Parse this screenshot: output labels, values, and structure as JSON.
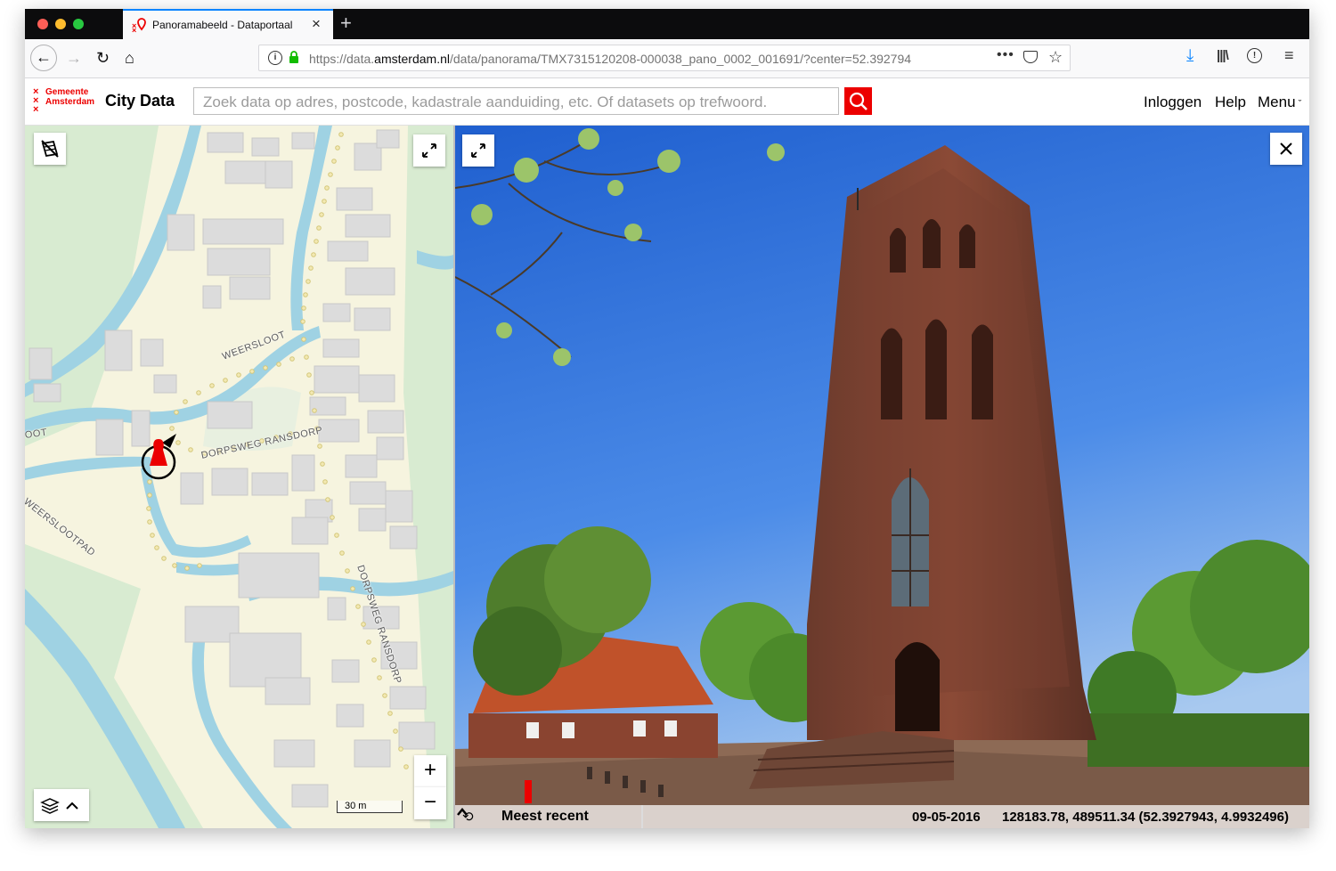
{
  "browser": {
    "tab_title": "Panoramabeeld - Dataportaal",
    "url_prefix": "https://data.",
    "url_domain": "amsterdam.nl",
    "url_path": "/data/panorama/TMX7315120208-000038_pano_0002_001691/?center=52.392794",
    "traffic_lights": [
      "#fd5f57",
      "#febc2e",
      "#28c840"
    ]
  },
  "header": {
    "logo_line1": "Gemeente",
    "logo_line2": "Amsterdam",
    "site_title": "City Data",
    "search_placeholder": "Zoek data op adres, postcode, kadastrale aanduiding, etc. Of datasets op trefwoord.",
    "nav": {
      "login": "Inloggen",
      "help": "Help",
      "menu": "Menu"
    },
    "accent_color": "#ec0000"
  },
  "map": {
    "streets": {
      "weersloot": "WEERSLOOT",
      "dorpsweg_horizontal": "DORPSWEG RANSDORP",
      "dorpsweg_vertical": "DORPSWEG RANSDORP",
      "weersslootpad": "WEERSLOOTPAD",
      "edge_label": "OOT"
    },
    "scale_label": "30 m",
    "zoom_in": "+",
    "zoom_out": "−",
    "colors": {
      "water": "#9fd2e3",
      "land": "#f6f4df",
      "grass": "#d8ebd1",
      "building": "#dcdcdc",
      "marker": "#ec0000"
    }
  },
  "panorama": {
    "history_label": "Meest recent",
    "date": "09-05-2016",
    "coordinates": "128183.78, 489511.34 (52.3927943, 4.9932496)"
  }
}
